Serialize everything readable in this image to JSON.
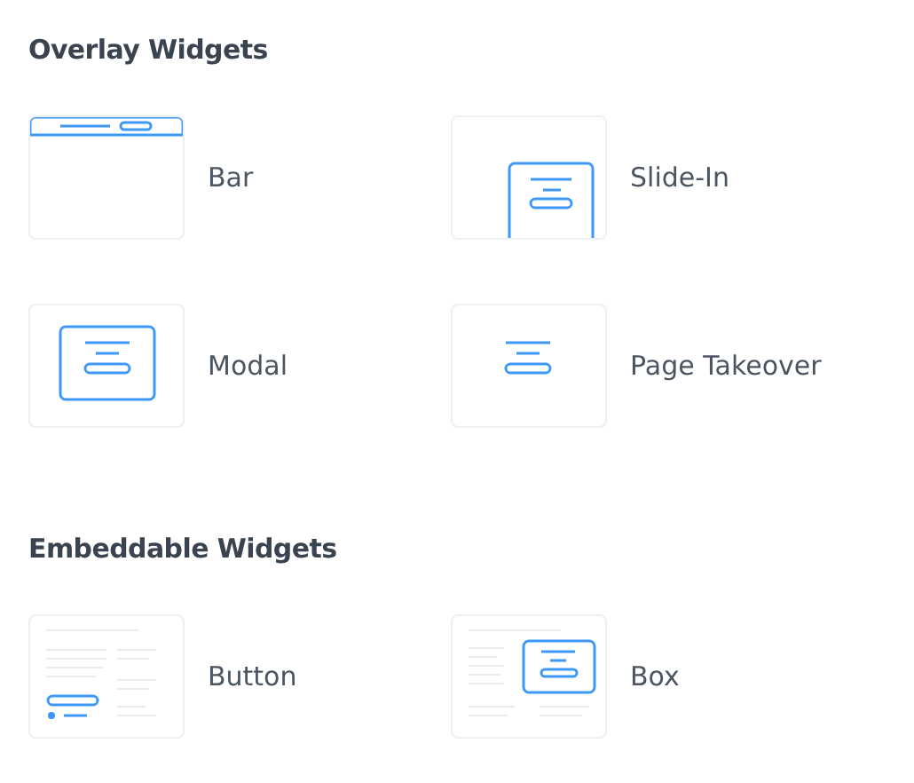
{
  "sections": [
    {
      "title": "Overlay Widgets",
      "widgets": [
        {
          "kind": "bar",
          "label": "Bar"
        },
        {
          "kind": "slidein",
          "label": "Slide-In"
        },
        {
          "kind": "modal",
          "label": "Modal"
        },
        {
          "kind": "takeover",
          "label": "Page Takeover"
        }
      ]
    },
    {
      "title": "Embeddable Widgets",
      "widgets": [
        {
          "kind": "button",
          "label": "Button"
        },
        {
          "kind": "box",
          "label": "Box"
        }
      ]
    }
  ]
}
